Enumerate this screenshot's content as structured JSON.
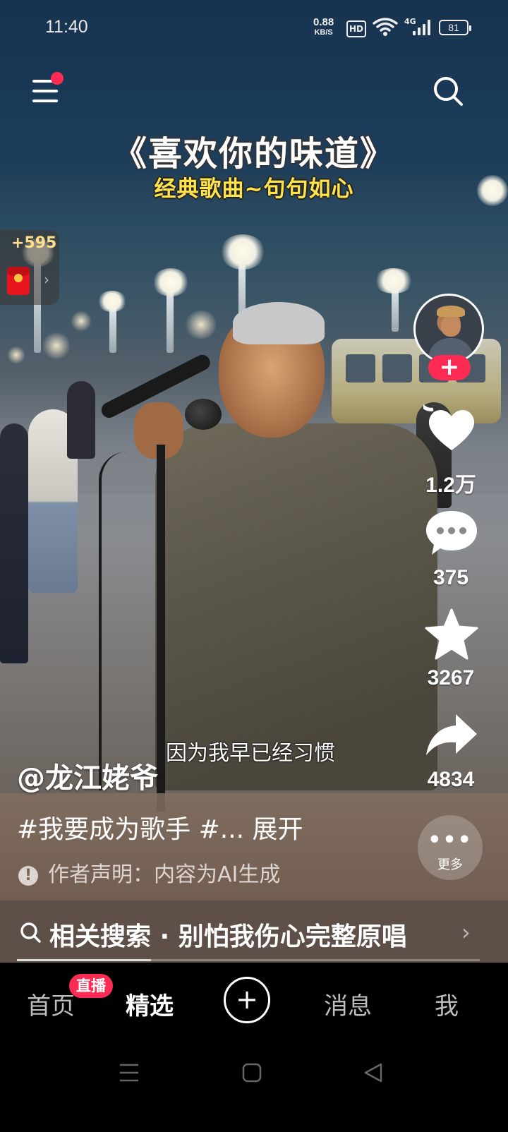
{
  "status_bar": {
    "time": "11:40",
    "net_speed": "0.88",
    "net_unit": "KB/S",
    "hd": "HD",
    "signal": "4G",
    "battery": "81"
  },
  "header": {
    "menu_icon": "menu-icon",
    "search_icon": "search-icon",
    "notification_dot_color": "#fe2c55"
  },
  "video": {
    "title": "《喜欢你的味道》",
    "subtitle": "经典歌曲~句句如心",
    "lyric": "因为我早已经习惯",
    "progress": 0.29
  },
  "red_packet": {
    "amount": "+595"
  },
  "actions": {
    "follow_label": "+",
    "likes": "1.2万",
    "comments": "375",
    "favorites": "3267",
    "shares": "4834"
  },
  "caption": {
    "author": "@龙江姥爷",
    "description": "#我要成为歌手 #... 展开",
    "declaration": "作者声明：内容为AI生成",
    "more_label": "更多"
  },
  "related": {
    "text": "相关搜索 · 别怕我伤心完整原唱"
  },
  "bottom_nav": {
    "home": "首页",
    "live_badge": "直播",
    "featured": "精选",
    "create": "+",
    "messages": "消息",
    "me": "我"
  },
  "colors": {
    "accent": "#fe2c55",
    "subtitle": "#ffe34a"
  }
}
